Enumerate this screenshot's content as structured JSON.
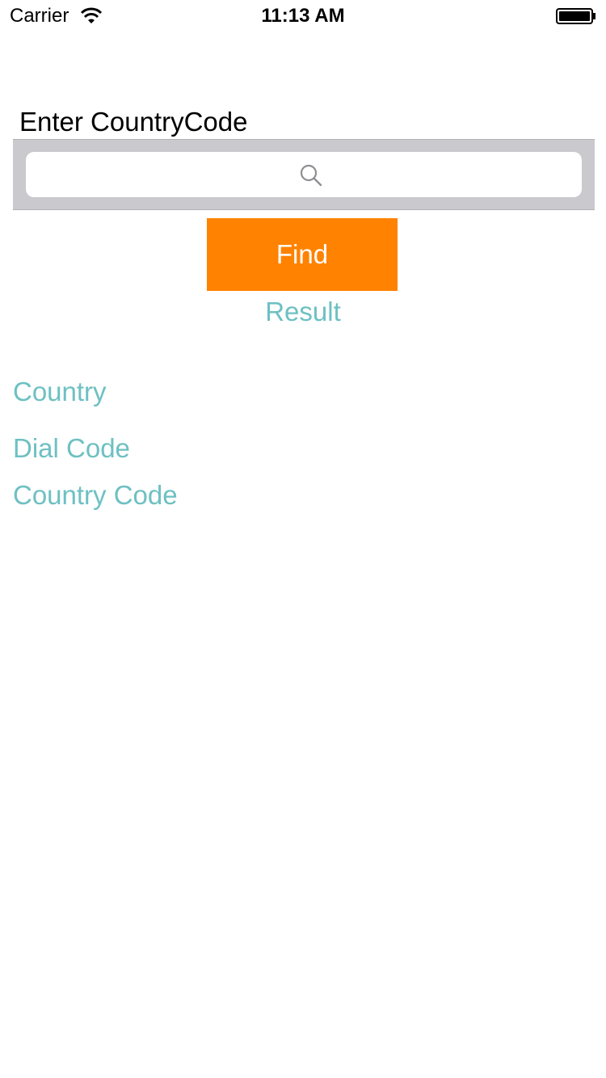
{
  "status_bar": {
    "carrier": "Carrier",
    "time": "11:13 AM",
    "wifi_icon": "wifi-icon",
    "battery_icon": "battery-icon"
  },
  "form": {
    "prompt": "Enter CountryCode",
    "search": {
      "value": "",
      "placeholder": "",
      "icon": "search-icon"
    },
    "find_button": "Find"
  },
  "results": {
    "heading": "Result",
    "country_label": "Country",
    "dial_code_label": "Dial Code",
    "country_code_label": "Country Code"
  },
  "colors": {
    "accent": "#ff8200",
    "result_text": "#6ec0c2",
    "search_bar_bg": "#c9c9ce"
  }
}
